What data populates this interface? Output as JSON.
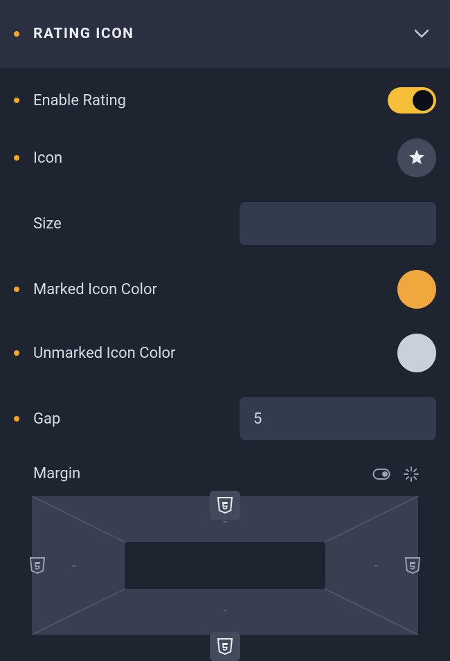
{
  "header": {
    "title": "RATING ICON"
  },
  "rows": {
    "enable_rating": {
      "label": "Enable Rating",
      "enabled": true
    },
    "icon": {
      "label": "Icon"
    },
    "size": {
      "label": "Size",
      "value": ""
    },
    "marked_color": {
      "label": "Marked Icon Color",
      "color": "#f0a73e"
    },
    "unmarked_color": {
      "label": "Unmarked Icon Color",
      "color": "#c8d1da"
    },
    "gap": {
      "label": "Gap",
      "value": "5"
    },
    "margin": {
      "label": "Margin",
      "top": "-",
      "right": "-",
      "bottom": "-",
      "left": "-"
    }
  },
  "colors": {
    "accent": "#f5a623",
    "toggle_on": "#f5c037"
  }
}
